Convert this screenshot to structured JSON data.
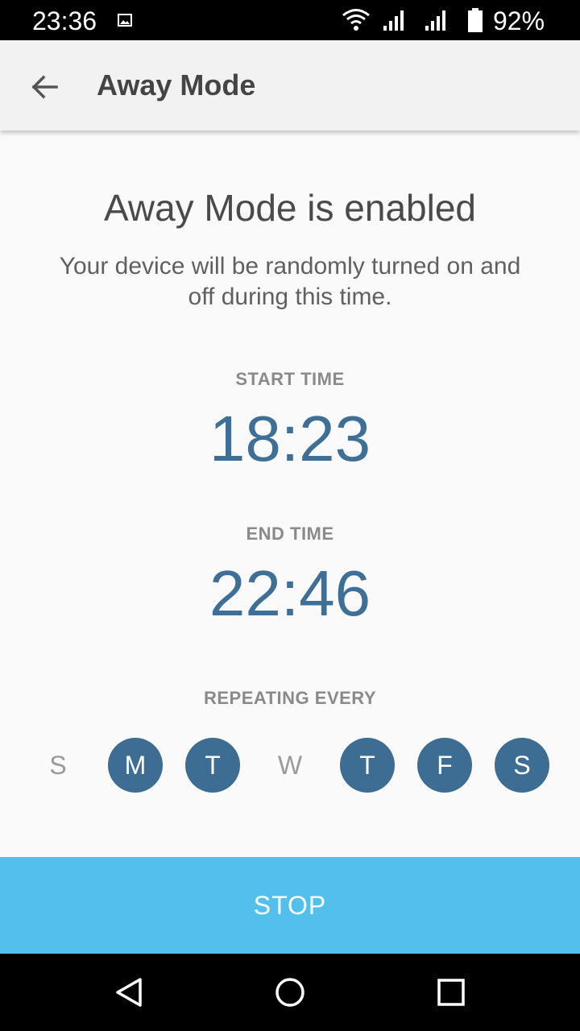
{
  "status_bar": {
    "time": "23:36",
    "battery": "92%"
  },
  "app_bar": {
    "title": "Away Mode",
    "back_icon": "arrow-back-icon"
  },
  "main": {
    "heading": "Away Mode is enabled",
    "description": "Your device will be randomly turned on and off during this time.",
    "start_label": "START TIME",
    "start_time": "18:23",
    "end_label": "END TIME",
    "end_time": "22:46",
    "repeat_label": "REPEATING EVERY",
    "days": [
      {
        "label": "S",
        "active": false
      },
      {
        "label": "M",
        "active": true
      },
      {
        "label": "T",
        "active": true
      },
      {
        "label": "W",
        "active": false
      },
      {
        "label": "T",
        "active": true
      },
      {
        "label": "F",
        "active": true
      },
      {
        "label": "S",
        "active": true
      }
    ]
  },
  "stop_button": {
    "label": "STOP"
  },
  "colors": {
    "accent": "#3e6d93",
    "stop": "#53bfec",
    "time_text": "#3e6f97"
  }
}
